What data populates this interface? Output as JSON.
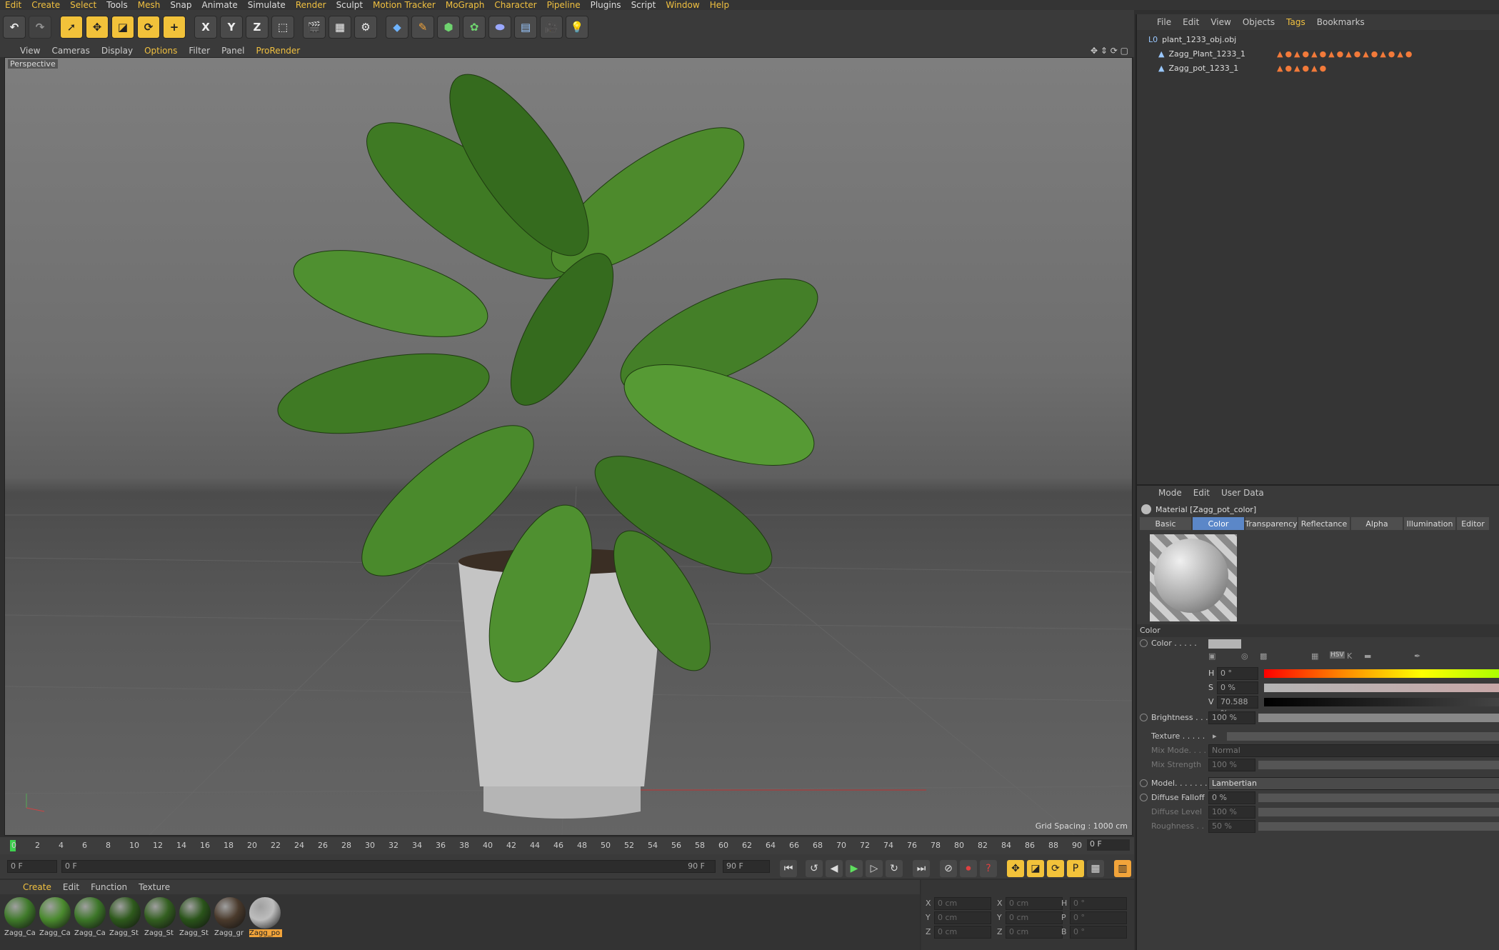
{
  "menu": [
    "Edit",
    "Create",
    "Select",
    "Tools",
    "Mesh",
    "Snap",
    "Animate",
    "Simulate",
    "Render",
    "Sculpt",
    "Motion Tracker",
    "MoGraph",
    "Character",
    "Pipeline",
    "Plugins",
    "Script",
    "Window",
    "Help"
  ],
  "toolbar": {
    "x_label": "X",
    "y_label": "Y",
    "z_label": "Z"
  },
  "viewport_menu": [
    "View",
    "Cameras",
    "Display",
    "Options",
    "Filter",
    "Panel",
    "ProRender"
  ],
  "viewport": {
    "label": "Perspective",
    "grid_spacing": "Grid Spacing : 1000 cm"
  },
  "timeline": {
    "ticks": [
      "0",
      "2",
      "4",
      "6",
      "8",
      "10",
      "12",
      "14",
      "16",
      "18",
      "20",
      "22",
      "24",
      "26",
      "28",
      "30",
      "32",
      "34",
      "36",
      "38",
      "40",
      "42",
      "44",
      "46",
      "48",
      "50",
      "52",
      "54",
      "56",
      "58",
      "60",
      "62",
      "64",
      "66",
      "68",
      "70",
      "72",
      "74",
      "76",
      "78",
      "80",
      "82",
      "84",
      "86",
      "88",
      "90"
    ],
    "current_frame": "0 F"
  },
  "playbar": {
    "start": "0 F",
    "range_start": "0 F",
    "range_end": "90 F",
    "end": "90 F"
  },
  "material_manager": {
    "menu": [
      "Create",
      "Edit",
      "Function",
      "Texture"
    ],
    "materials": [
      {
        "label": "Zagg_Ca",
        "color": "#3f7a2a"
      },
      {
        "label": "Zagg_Ca",
        "color": "#4a8a2e"
      },
      {
        "label": "Zagg_Ca",
        "color": "#3c7628"
      },
      {
        "label": "Zagg_St",
        "color": "#2e5a1c"
      },
      {
        "label": "Zagg_St",
        "color": "#335f20"
      },
      {
        "label": "Zagg_St",
        "color": "#2a541a"
      },
      {
        "label": "Zagg_gr",
        "color": "#4a3a2c"
      },
      {
        "label": "Zagg_po",
        "color": "#bdbdbd"
      }
    ]
  },
  "coordinates": {
    "rows": [
      {
        "a": "X",
        "av": "0 cm",
        "b": "X",
        "bv": "0 cm",
        "c": "H",
        "cv": "0 °"
      },
      {
        "a": "Y",
        "av": "0 cm",
        "b": "Y",
        "bv": "0 cm",
        "c": "P",
        "cv": "0 °"
      },
      {
        "a": "Z",
        "av": "0 cm",
        "b": "Z",
        "bv": "0 cm",
        "c": "B",
        "cv": "0 °"
      }
    ]
  },
  "object_manager": {
    "menu": [
      "File",
      "Edit",
      "View",
      "Objects",
      "Tags",
      "Bookmarks"
    ],
    "objects": [
      "plant_1233_obj.obj",
      "Zagg_Plant_1233_1",
      "Zagg_pot_1233_1"
    ]
  },
  "attribute_manager": {
    "menu": [
      "Mode",
      "Edit",
      "User Data"
    ],
    "title": "Material [Zagg_pot_color]",
    "tabs": [
      "Basic",
      "Color",
      "Transparency",
      "Reflectance",
      "Alpha",
      "Illumination",
      "Editor"
    ],
    "section": "Color",
    "color_label": "Color . . . . .",
    "h_label": "H",
    "h_value": "0 °",
    "s_label": "S",
    "s_value": "0 %",
    "v_label": "V",
    "v_value": "70.588 %",
    "hsv_label": "HSV",
    "brightness_label": "Brightness . . .",
    "brightness_value": "100 %",
    "texture_label": "Texture . . . . .",
    "mixmode_label": "Mix Mode. . . .",
    "mixmode_value": "Normal",
    "mixstrength_label": "Mix Strength",
    "mixstrength_value": "100 %",
    "model_label": "Model. . . . . . .",
    "model_value": "Lambertian",
    "diffuse_falloff_label": "Diffuse Falloff",
    "diffuse_falloff_value": "0 %",
    "diffuse_level_label": "Diffuse Level",
    "diffuse_level_value": "100 %",
    "roughness_label": "Roughness . .",
    "roughness_value": "50 %"
  }
}
